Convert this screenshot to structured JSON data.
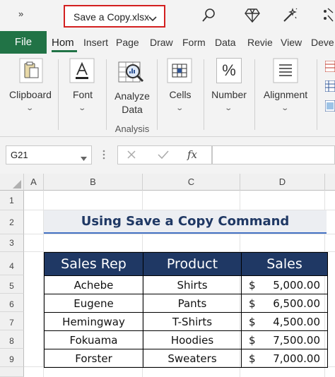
{
  "titlebar": {
    "overflow_label": "»",
    "filename": "Save a Copy.xlsx"
  },
  "ribbon_tabs": [
    "File",
    "Hom",
    "Insert",
    "Page",
    "Draw",
    "Form",
    "Data",
    "Revie",
    "View",
    "Deve"
  ],
  "ribbon": {
    "clipboard": "Clipboard",
    "font": "Font",
    "analyze_data_line1": "Analyze",
    "analyze_data_line2": "Data",
    "analysis_group": "Analysis",
    "cells": "Cells",
    "number": "Number",
    "number_icon": "%",
    "alignment": "Alignment"
  },
  "formula_bar": {
    "name_box": "G21",
    "fx": "fx",
    "formula": ""
  },
  "columns": [
    "A",
    "B",
    "C",
    "D"
  ],
  "rows": [
    "1",
    "2",
    "3",
    "4",
    "5",
    "6",
    "7",
    "8",
    "9"
  ],
  "sheet": {
    "title": "Using Save a Copy Command",
    "headers": [
      "Sales Rep",
      "Product",
      "Sales"
    ],
    "records": [
      {
        "rep": "Achebe",
        "product": "Shirts",
        "currency": "$",
        "amount": "5,000.00"
      },
      {
        "rep": "Eugene",
        "product": "Pants",
        "currency": "$",
        "amount": "6,500.00"
      },
      {
        "rep": "Hemingway",
        "product": "T-Shirts",
        "currency": "$",
        "amount": "4,500.00"
      },
      {
        "rep": "Fokuama",
        "product": "Hoodies",
        "currency": "$",
        "amount": "7,500.00"
      },
      {
        "rep": "Forster",
        "product": "Sweaters",
        "currency": "$",
        "amount": "7,000.00"
      }
    ]
  },
  "colors": {
    "file_tab": "#217346",
    "header_fill": "#1f3864",
    "title_underline": "#4472c4",
    "filename_highlight": "#d32020"
  }
}
